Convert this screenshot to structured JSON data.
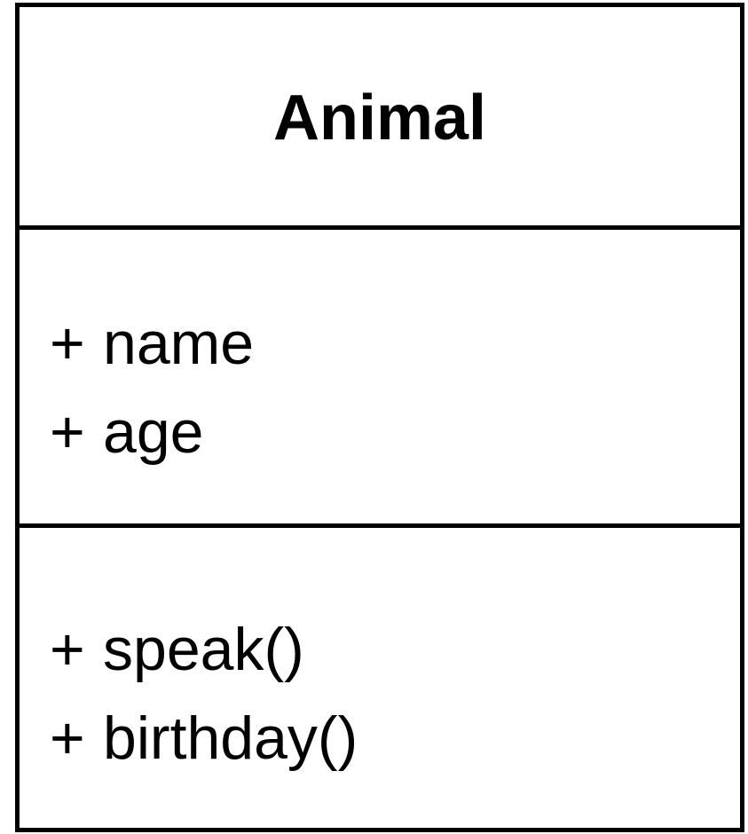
{
  "class": {
    "name": "Animal",
    "attributes": [
      {
        "visibility": "+",
        "name": "name"
      },
      {
        "visibility": "+",
        "name": "age"
      }
    ],
    "methods": [
      {
        "visibility": "+",
        "name": "speak()"
      },
      {
        "visibility": "+",
        "name": "birthday()"
      }
    ]
  },
  "colors": {
    "border": "#000000",
    "background": "#ffffff",
    "text": "#000000"
  }
}
